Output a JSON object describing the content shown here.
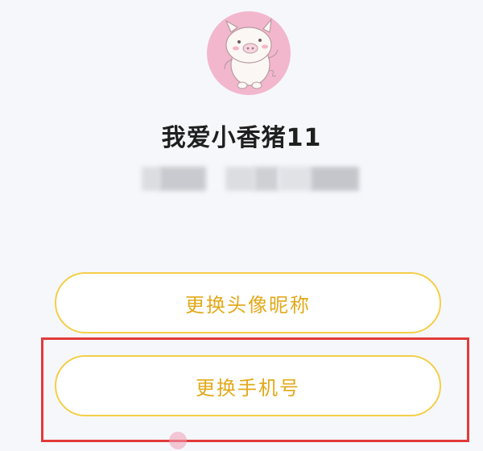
{
  "profile": {
    "avatar_icon": "pig-avatar-icon",
    "username": "我爱小香猪11",
    "masked_info_note": ""
  },
  "buttons": {
    "change_avatar_nickname": "更换头像昵称",
    "change_phone": "更换手机号"
  },
  "bottom_link": {
    "text": "",
    "icon": "pig-icon"
  },
  "colors": {
    "accent_border": "#f3cf48",
    "button_text": "#e2a91a",
    "highlight": "#e13a3a",
    "avatar_bg": "#f2b7cd"
  }
}
